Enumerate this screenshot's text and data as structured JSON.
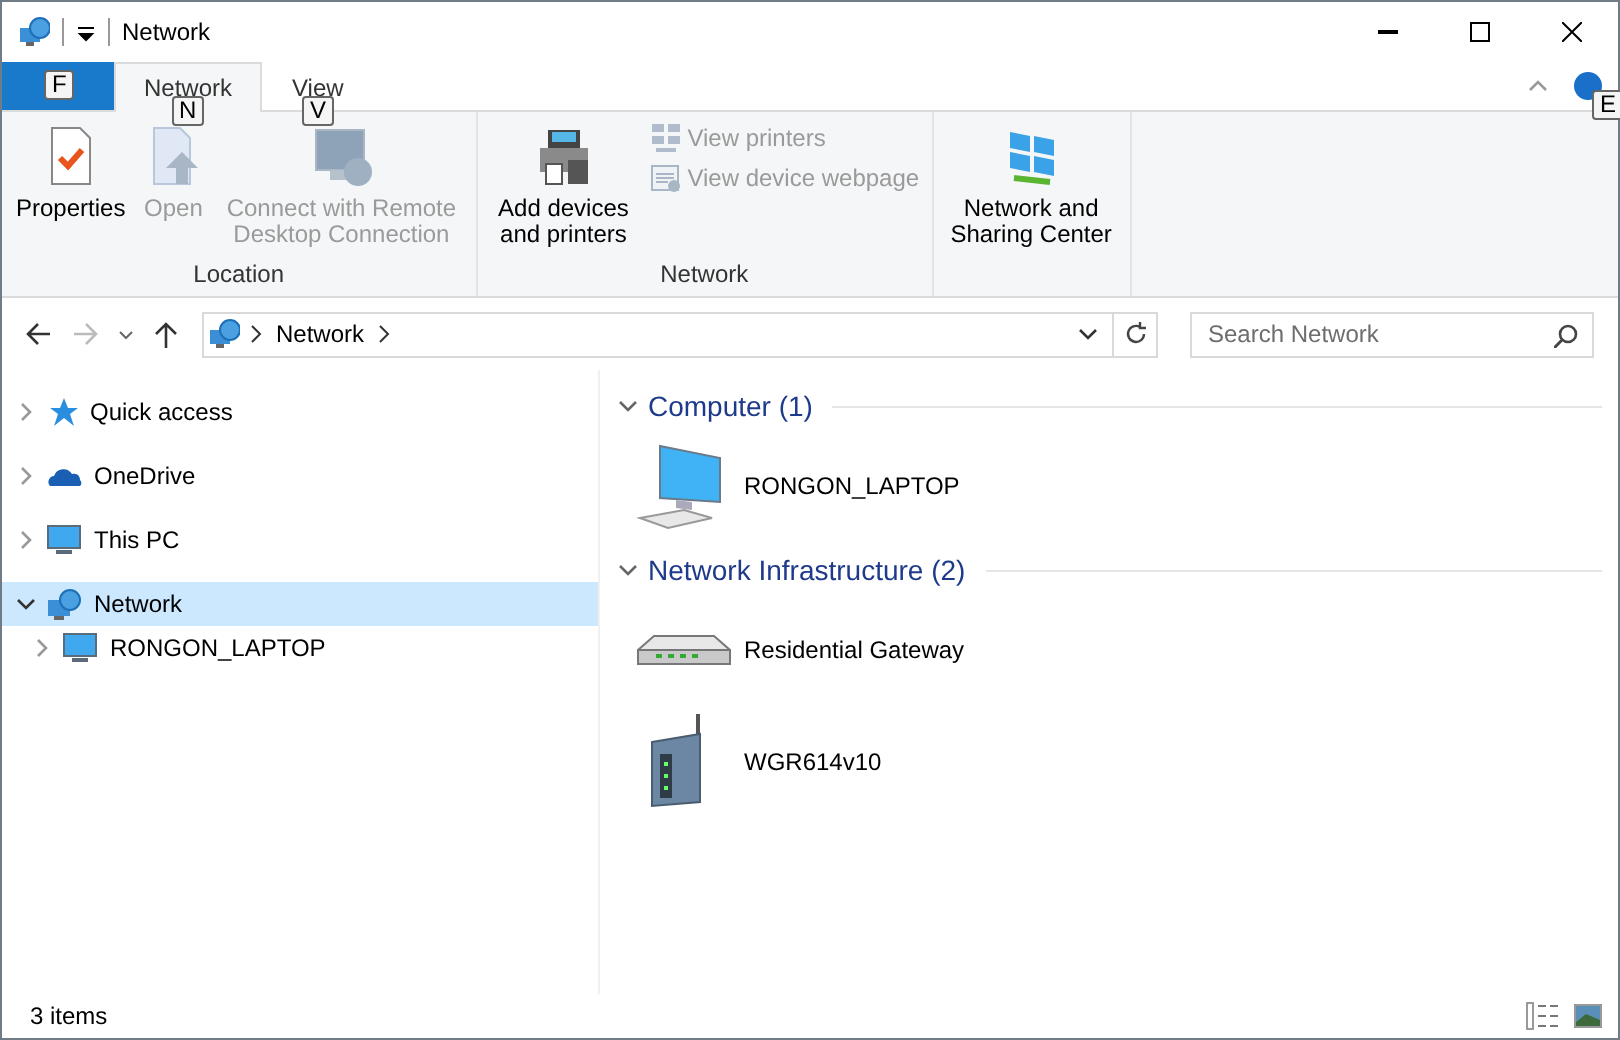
{
  "window": {
    "title": "Network"
  },
  "file_tab": {
    "keytip": "F"
  },
  "tabs": [
    {
      "label": "Network",
      "selected": true,
      "keytip": "N"
    },
    {
      "label": "View",
      "selected": false,
      "keytip": "V"
    }
  ],
  "help_keytip": "E",
  "ribbon_groups": [
    {
      "label": "Location",
      "commands": [
        {
          "label": "Properties",
          "kind": "properties",
          "disabled": false
        },
        {
          "label": "Open",
          "kind": "open",
          "disabled": true
        },
        {
          "label": "Connect with Remote Desktop Connection",
          "kind": "remote",
          "disabled": true
        }
      ]
    },
    {
      "label": "Network",
      "commands": [
        {
          "label": "Add devices and printers",
          "kind": "devices",
          "disabled": false
        },
        {
          "label": "View printers",
          "kind": "printers",
          "disabled": true
        },
        {
          "label": "View device webpage",
          "kind": "webpage",
          "disabled": true
        }
      ]
    },
    {
      "commands": [
        {
          "label": "Network and Sharing Center",
          "kind": "sharing",
          "disabled": false
        }
      ]
    }
  ],
  "address": {
    "segments": [
      "Network"
    ]
  },
  "search": {
    "placeholder": "Search Network"
  },
  "sidebar": {
    "items": [
      {
        "label": "Quick access",
        "kind": "star",
        "expanded": false,
        "selected": false
      },
      {
        "label": "OneDrive",
        "kind": "cloud",
        "expanded": false,
        "selected": false
      },
      {
        "label": "This PC",
        "kind": "pc",
        "expanded": false,
        "selected": false
      },
      {
        "label": "Network",
        "kind": "network",
        "expanded": true,
        "selected": true,
        "children": [
          {
            "label": "RONGON_LAPTOP",
            "kind": "pc",
            "expanded": false,
            "selected": false
          }
        ]
      }
    ]
  },
  "groups": [
    {
      "title": "Computer (1)",
      "expanded": true,
      "items": [
        {
          "label": "RONGON_LAPTOP",
          "kind": "computer"
        }
      ]
    },
    {
      "title": "Network Infrastructure (2)",
      "expanded": true,
      "items": [
        {
          "label": "Residential Gateway",
          "kind": "gateway"
        },
        {
          "label": "WGR614v10",
          "kind": "router"
        }
      ]
    }
  ],
  "status_bar": {
    "count": "3 items"
  }
}
